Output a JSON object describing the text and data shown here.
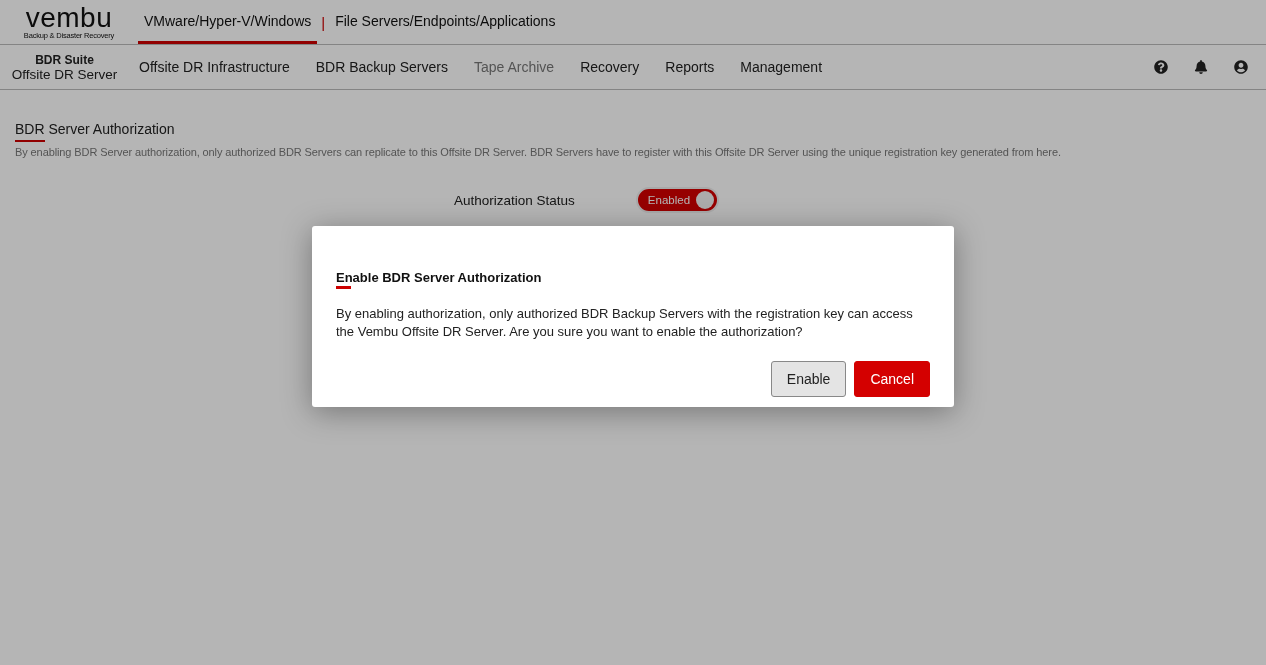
{
  "logo": {
    "name": "vembu",
    "tagline": "Backup & Disaster Recovery"
  },
  "product_tabs": [
    {
      "label": "VMware/Hyper-V/Windows",
      "selected": true
    },
    {
      "label": "File Servers/Endpoints/Applications",
      "selected": false
    }
  ],
  "product_separator": "|",
  "suite": {
    "title": "BDR Suite",
    "subtitle": "Offsite DR Server"
  },
  "nav": [
    {
      "label": "Offsite DR Infrastructure",
      "disabled": false
    },
    {
      "label": "BDR Backup Servers",
      "disabled": false
    },
    {
      "label": "Tape Archive",
      "disabled": true
    },
    {
      "label": "Recovery",
      "disabled": false
    },
    {
      "label": "Reports",
      "disabled": false
    },
    {
      "label": "Management",
      "disabled": false
    }
  ],
  "section": {
    "title": "BDR Server Authorization",
    "description": "By enabling BDR Server authorization, only authorized BDR Servers can replicate to this Offsite DR Server. BDR Servers have to register with this Offsite DR Server using the unique registration key generated from here."
  },
  "authorization": {
    "label": "Authorization Status",
    "toggle_text": "Enabled",
    "on": true
  },
  "dialog": {
    "title": "Enable BDR Server Authorization",
    "message": "By enabling authorization, only authorized BDR Backup Servers with the registration key can access the Vembu Offsite DR Server. Are you sure you want to enable the authorization?",
    "buttons": [
      {
        "label": "Enable",
        "kind": "secondary"
      },
      {
        "label": "Cancel",
        "kind": "primary"
      }
    ]
  }
}
